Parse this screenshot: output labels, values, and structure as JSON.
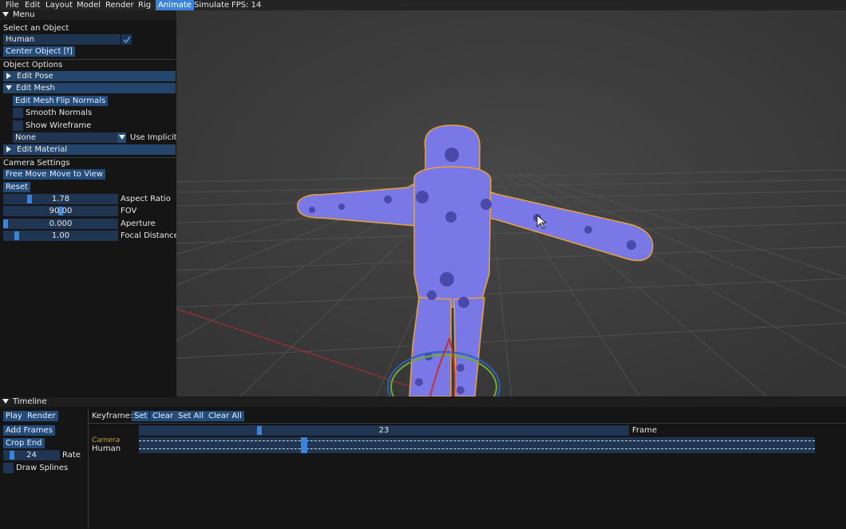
{
  "menubar": {
    "items": [
      "File",
      "Edit",
      "Layout",
      "Model",
      "Render",
      "Rig",
      "Animate",
      "Simulate"
    ],
    "active": "Animate",
    "fps": "FPS: 14"
  },
  "menu": {
    "title": "Menu",
    "select_object_label": "Select an Object",
    "selected_object": "Human",
    "center_object_button": "Center Object [f]",
    "object_options_label": "Object Options",
    "edit_pose": "Edit Pose",
    "edit_mesh": "Edit Mesh",
    "edit_mesh_button": "Edit Mesh",
    "flip_normals_button": "Flip Normals",
    "smooth_normals": "Smooth Normals",
    "show_wireframe": "Show Wireframe",
    "dropdown_value": "None",
    "use_implicit": "Use Implicit S",
    "edit_material": "Edit Material",
    "camera_settings_label": "Camera Settings",
    "free_move_button": "Free Move",
    "move_to_view_button": "Move to View",
    "reset_button": "Reset",
    "sliders": [
      {
        "value": "1.78",
        "label": "Aspect Ratio",
        "fraction": 0.22
      },
      {
        "value": "90.00",
        "label": "FOV",
        "fraction": 0.5
      },
      {
        "value": "0.000",
        "label": "Aperture",
        "fraction": 0.0
      },
      {
        "value": "1.00",
        "label": "Focal Distance",
        "fraction": 0.1
      }
    ]
  },
  "timeline": {
    "title": "Timeline",
    "play_button": "Play",
    "render_button": "Render",
    "add_frames_button": "Add Frames",
    "crop_end_button": "Crop End",
    "rate_value": "24",
    "rate_label": "Rate",
    "draw_splines": "Draw Splines",
    "keyframe_label": "Keyframe:",
    "set_button": "Set",
    "clear_button": "Clear",
    "set_all_button": "Set All",
    "clear_all_button": "Clear All",
    "frame_value": "23",
    "frame_label": "Frame",
    "tracks": [
      "Camera",
      "Human"
    ]
  },
  "colors": {
    "accent": "#3a83d8",
    "button": "#234c7a",
    "field": "#1f3551",
    "mesh": "#7a78e6",
    "outline": "#e8a23a"
  }
}
